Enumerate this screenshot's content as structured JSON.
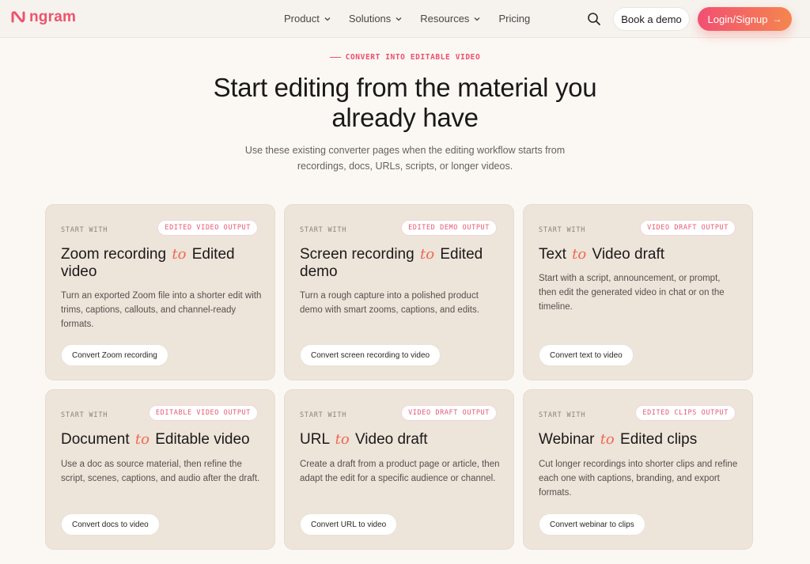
{
  "brand": {
    "name": "ngram",
    "color": "#f0526b"
  },
  "nav": {
    "items": [
      {
        "label": "Product",
        "has_dropdown": true
      },
      {
        "label": "Solutions",
        "has_dropdown": true
      },
      {
        "label": "Resources",
        "has_dropdown": true
      },
      {
        "label": "Pricing",
        "has_dropdown": false
      }
    ],
    "book_demo": "Book a demo",
    "login": "Login/Signup",
    "search_icon": "search-icon"
  },
  "hero": {
    "eyebrow": "CONVERT INTO EDITABLE VIDEO",
    "title_line1": "Start editing from the material you",
    "title_line2": "already have",
    "subtitle_line1": "Use these existing converter pages when the editing workflow starts from",
    "subtitle_line2": "recordings, docs, URLs, scripts, or longer videos."
  },
  "cards": [
    {
      "start": "START WITH",
      "badge": "EDITED VIDEO OUTPUT",
      "source": "Zoom recording",
      "to": "to",
      "target": "Edited video",
      "desc": "Turn an exported Zoom file into a shorter edit with trims, captions, callouts, and channel-ready formats.",
      "button": "Convert Zoom recording"
    },
    {
      "start": "START WITH",
      "badge": "EDITED DEMO OUTPUT",
      "source": "Screen recording",
      "to": "to",
      "target": "Edited demo",
      "desc": "Turn a rough capture into a polished product demo with smart zooms, captions, and edits.",
      "button": "Convert screen recording to video"
    },
    {
      "start": "START WITH",
      "badge": "VIDEO DRAFT OUTPUT",
      "source": "Text",
      "to": "to",
      "target": "Video draft",
      "desc": "Start with a script, announcement, or prompt, then edit the generated video in chat or on the timeline.",
      "button": "Convert text to video"
    },
    {
      "start": "START WITH",
      "badge": "EDITABLE VIDEO OUTPUT",
      "source": "Document",
      "to": "to",
      "target": "Editable video",
      "desc": "Use a doc as source material, then refine the script, scenes, captions, and audio after the draft.",
      "button": "Convert docs to video"
    },
    {
      "start": "START WITH",
      "badge": "VIDEO DRAFT OUTPUT",
      "source": "URL",
      "to": "to",
      "target": "Video draft",
      "desc": "Create a draft from a product page or article, then adapt the edit for a specific audience or channel.",
      "button": "Convert URL to video"
    },
    {
      "start": "START WITH",
      "badge": "EDITED CLIPS OUTPUT",
      "source": "Webinar",
      "to": "to",
      "target": "Edited clips",
      "desc": "Cut longer recordings into shorter clips and refine each one with captions, branding, and export formats.",
      "button": "Convert webinar to clips"
    }
  ]
}
